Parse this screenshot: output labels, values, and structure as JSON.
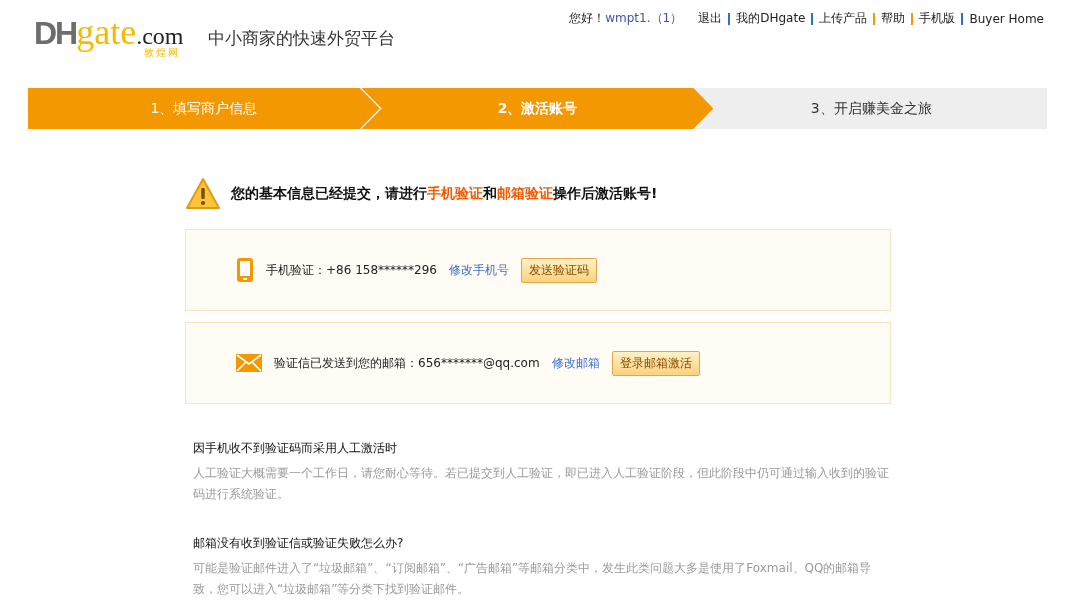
{
  "logo": {
    "part_1": "DH",
    "part_2": "gate",
    ".com": ".com",
    "subtitle": "敦煌网"
  },
  "slogan": "中小商家的快速外贸平台",
  "top_nav": {
    "greeting": "您好！",
    "user": "wmpt1.（1）",
    "links": [
      "退出",
      "我的DHgate",
      "上传产品",
      "帮助",
      "手机版",
      "Buyer Home"
    ]
  },
  "steps": [
    {
      "label": "1、填写商户信息",
      "selected": false,
      "done": true
    },
    {
      "label": "2、激活账号",
      "selected": true,
      "done": true
    },
    {
      "label": "3、开启赚美金之旅",
      "selected": false,
      "done": false
    }
  ],
  "notice": [
    {
      "text": "您的基本信息已经提交，请进行",
      "highlight": false
    },
    {
      "text": "手机验证",
      "highlight": true
    },
    {
      "text": "和",
      "highlight": false
    },
    {
      "text": "邮箱验证",
      "highlight": true
    },
    {
      "text": "操作后激活账号!",
      "highlight": false
    }
  ],
  "cards": [
    {
      "kind": "phone",
      "label": "手机验证：+86  158******296",
      "link": "修改手机号",
      "button": "发送验证码"
    },
    {
      "kind": "email",
      "label": "验证信已发送到您的邮箱：656*******@qq.com",
      "link": "修改邮箱",
      "button": "登录邮箱激活"
    }
  ],
  "faq": [
    {
      "question": "因手机收不到验证码而采用人工激活时",
      "answer": "人工验证大概需要一个工作日，请您耐心等待。若已提交到人工验证，即已进入人工验证阶段，但此阶段中仍可通过输入收到的验证码进行系统验证。"
    },
    {
      "question": "邮箱没有收到验证信或验证失败怎么办?",
      "answer": "可能是验证邮件进入了“垃圾邮箱”、“订阅邮箱”、“广告邮箱”等邮箱分类中，发生此类问题大多是使用了Foxmail、QQ的邮箱导致，您可以进入“垃圾邮箱”等分类下找到验证邮件。"
    }
  ]
}
